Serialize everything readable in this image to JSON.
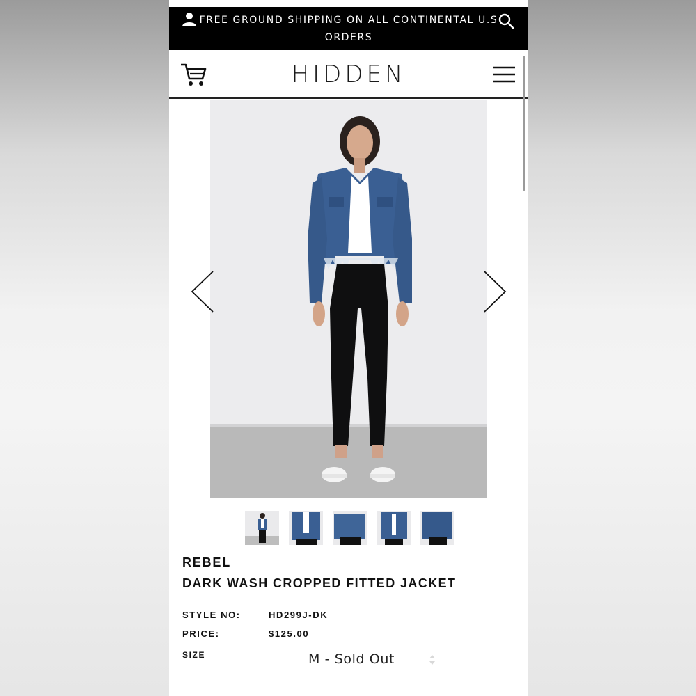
{
  "promo": {
    "text": "FREE GROUND SHIPPING ON ALL CONTINENTAL U.S ORDERS",
    "icons": [
      "user-icon",
      "search-icon"
    ]
  },
  "header": {
    "logo": "HIDDEN",
    "icons": [
      "cart-icon",
      "hamburger-menu-icon"
    ]
  },
  "gallery": {
    "controls": [
      "chevron-left-icon",
      "chevron-right-icon"
    ],
    "thumbnail_count": 5
  },
  "product": {
    "brand": "REBEL",
    "name": "DARK WASH CROPPED FITTED JACKET",
    "style_label": "STYLE NO:",
    "style_value": "HD299J-DK",
    "price_label": "PRICE:",
    "price_value": "$125.00",
    "size_label": "SIZE",
    "size_selected": "M - Sold Out"
  },
  "colors": {
    "promo_bg": "#000000",
    "denim": "#3a5f93",
    "text": "#111111"
  }
}
